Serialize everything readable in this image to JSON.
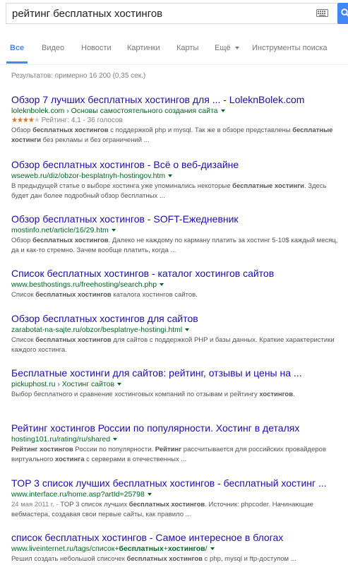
{
  "search": {
    "query": "рейтинг бесплатных хостингов"
  },
  "tabs": [
    {
      "label": "Все"
    },
    {
      "label": "Видео"
    },
    {
      "label": "Новости"
    },
    {
      "label": "Картинки"
    },
    {
      "label": "Карты"
    },
    {
      "label": "Ещё"
    },
    {
      "label": "Инструменты поиска"
    }
  ],
  "stats": "Результатов: примерно 16 200 (0,35 сек.)",
  "results": [
    {
      "title": "Обзор 7 лучших бесплатных хостингов для ... - LoleknBolek.com",
      "url": "loleknbolek.com › Основы самостоятельного создания сайта",
      "rating": {
        "stars": 4,
        "text": "Рейтинг: 4,1 - 36 голосов"
      },
      "snippet": [
        {
          "t": "Обзор ",
          "b": false
        },
        {
          "t": "бесплатных хостингов",
          "b": true
        },
        {
          "t": " с поддержкой php и mysql. Так же в обзоре представлены ",
          "b": false
        },
        {
          "t": "бесплатные хостинги",
          "b": true
        },
        {
          "t": " без рекламы и без ограничений ...",
          "b": false
        }
      ]
    },
    {
      "title": "Обзор бесплатных хостингов - Всё о веб-дизайне",
      "url": "wseweb.ru/diz/obzor-besplatnyh-hostingov.htm",
      "snippet": [
        {
          "t": "В предыдущей статье о выборе хостинга уже упоминались некоторые ",
          "b": false
        },
        {
          "t": "бесплатные хостинги",
          "b": true
        },
        {
          "t": ". Здесь будет дан более подробный обзор бесплатных ...",
          "b": false
        }
      ]
    },
    {
      "title": "Обзор бесплатных хостингов - SOFT-Ежедневник",
      "url": "mostinfo.net/article/16/29.htm",
      "snippet": [
        {
          "t": "Обзор ",
          "b": false
        },
        {
          "t": "бесплатных хостингов",
          "b": true
        },
        {
          "t": ". Далеко не каждому по карману платить за хостинг 5-10$ каждый месяц, да и как-то стремно. Зачем вообще платить, когда ...",
          "b": false
        }
      ]
    },
    {
      "title": "Список бесплатных хостингов - каталог хостингов сайтов",
      "url": "www.besthostings.ru/freehosting/search.php",
      "snippet": [
        {
          "t": "Список ",
          "b": false
        },
        {
          "t": "бесплатных хостингов",
          "b": true
        },
        {
          "t": " каталога хостингов сайтов.",
          "b": false
        }
      ]
    },
    {
      "title": "Обзор бесплатных хостингов для сайтов",
      "url": "zarabotat-na-sajte.ru/obzor/besplatnye-hostingi.html",
      "snippet": [
        {
          "t": "Список ",
          "b": false
        },
        {
          "t": "бесплатных хостингов",
          "b": true
        },
        {
          "t": " для сайтов с поддержкой PHP и базы данных. Краткие характеристики каждого хостинга.",
          "b": false
        }
      ]
    },
    {
      "title": "Бесплатные хостинги для сайтов: рейтинг, отзывы и цены на ...",
      "url": "pickuphost.ru › Хостинг сайтов",
      "snippet": [
        {
          "t": "Выбор бесплатного и сравнение хостинговых компаний по отзывам и рейтингу ",
          "b": false
        },
        {
          "t": "хостингов",
          "b": true
        },
        {
          "t": ".",
          "b": false
        }
      ]
    },
    {
      "title": "Рейтинг хостингов России по популярности. Хостинг в деталях",
      "url": "hosting101.ru/rating/ru/shared",
      "snippet": [
        {
          "t": "Рейтинг хостингов",
          "b": true
        },
        {
          "t": " России по популярности. ",
          "b": false
        },
        {
          "t": "Рейтинг",
          "b": true
        },
        {
          "t": " рассчитывается для российских провайдеров виртуального ",
          "b": false
        },
        {
          "t": "хостинга",
          "b": true
        },
        {
          "t": " с серверами в отечественных ...",
          "b": false
        }
      ]
    },
    {
      "title": "TOP 3 список лучших бесплатных хостингов - бесплатный хостинг ...",
      "url": "www.interface.ru/home.asp?artId=25798",
      "date": "24 мая 2011 г. - ",
      "snippet": [
        {
          "t": "TOP 3 список лучших ",
          "b": false
        },
        {
          "t": "бесплатных хостингов",
          "b": true
        },
        {
          "t": ". Источник: phpcoder. Начинающие вебмастера, создавая свои первые сайты, как правило ...",
          "b": false
        }
      ]
    },
    {
      "title": "список бесплатных хостингов - Самое интересное в блогах",
      "url_parts": [
        {
          "t": "www.liveinternet.ru/tags/список+",
          "b": false
        },
        {
          "t": "бесплатных",
          "b": true
        },
        {
          "t": "+",
          "b": false
        },
        {
          "t": "хостингов",
          "b": true
        },
        {
          "t": "/",
          "b": false
        }
      ],
      "snippet": [
        {
          "t": "Решил создать небольшой списочек ",
          "b": false
        },
        {
          "t": "бесплатных хостингов",
          "b": true
        },
        {
          "t": " с php, mysql и ftp-доступом ...",
          "b": false
        }
      ]
    }
  ]
}
